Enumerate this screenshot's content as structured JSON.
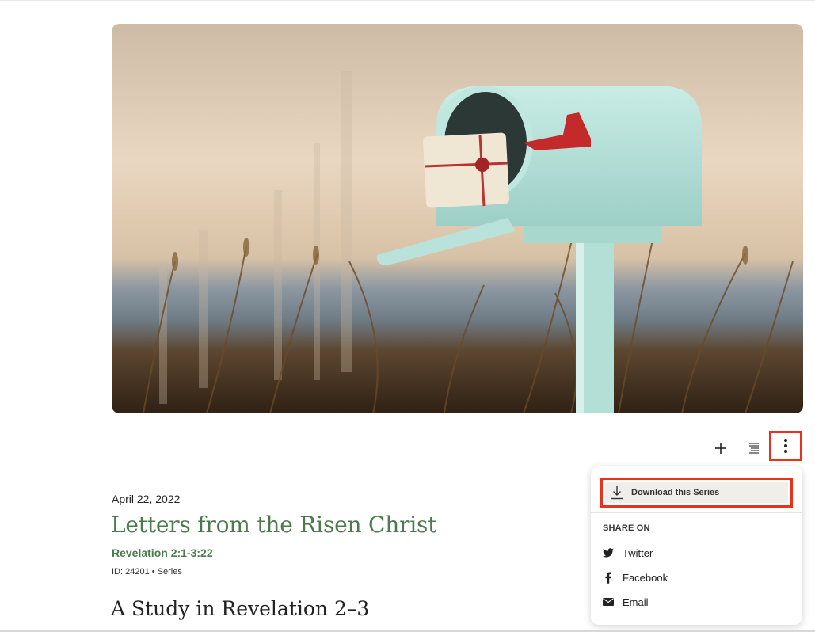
{
  "series": {
    "hero_alt": "Mailbox with letters in a field of tall grass",
    "date": "April 22, 2022",
    "title": "Letters from the Risen Christ",
    "scripture": "Revelation 2:1-3:22",
    "meta": "ID: 24201 • Series",
    "subtitle": "A Study in Revelation 2–3"
  },
  "actions": {
    "add_icon": "plus-icon",
    "list_icon": "list-icon",
    "more_icon": "vertical-ellipsis-icon"
  },
  "menu": {
    "download_label": "Download this Series",
    "download_icon": "download-icon",
    "share_heading": "SHARE ON",
    "share_items": [
      {
        "label": "Twitter",
        "icon": "twitter-icon"
      },
      {
        "label": "Facebook",
        "icon": "facebook-icon"
      },
      {
        "label": "Email",
        "icon": "envelope-icon"
      }
    ]
  },
  "colors": {
    "accent_green": "#4b7a4d",
    "highlight_red": "#e8321b",
    "menu_hover": "#efeee9"
  }
}
